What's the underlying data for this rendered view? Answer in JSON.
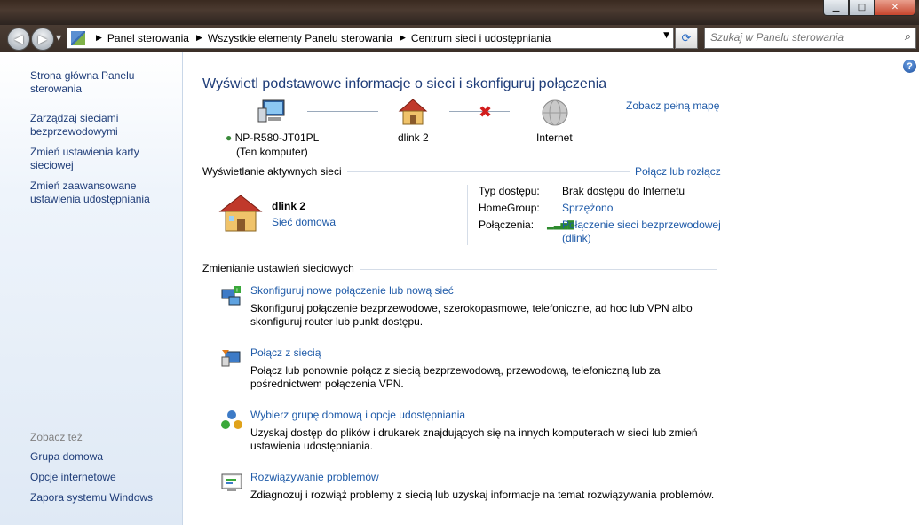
{
  "window": {
    "minimize": "▁",
    "maximize": "□",
    "close": "✕"
  },
  "nav": {
    "back": "◀",
    "forward": "▶",
    "breadcrumb": [
      "Panel sterowania",
      "Wszystkie elementy Panelu sterowania",
      "Centrum sieci i udostępniania"
    ],
    "search_placeholder": "Szukaj w Panelu sterowania"
  },
  "sidebar": {
    "items": [
      "Strona główna Panelu sterowania",
      "Zarządzaj sieciami bezprzewodowymi",
      "Zmień ustawienia karty sieciowej",
      "Zmień zaawansowane ustawienia udostępniania"
    ],
    "see_also": "Zobacz też",
    "see_items": [
      "Grupa domowa",
      "Opcje internetowe",
      "Zapora systemu Windows"
    ]
  },
  "main": {
    "title": "Wyświetl podstawowe informacje o sieci i skonfiguruj połączenia",
    "full_map": "Zobacz pełną mapę",
    "map": {
      "computer": "NP-R580-JT01PL",
      "computer_sub": "(Ten komputer)",
      "network": "dlink  2",
      "internet": "Internet"
    },
    "active": {
      "section": "Wyświetlanie aktywnych sieci",
      "connect": "Połącz lub rozłącz",
      "name": "dlink  2",
      "type": "Sieć domowa",
      "access_label": "Typ dostępu:",
      "access_value": "Brak dostępu do Internetu",
      "hg_label": "HomeGroup:",
      "hg_value": "Sprzężono",
      "conn_label": "Połączenia:",
      "conn_value_1": "Połączenie sieci bezprzewodowej",
      "conn_value_2": "(dlink)"
    },
    "settings": {
      "section": "Zmienianie ustawień sieciowych",
      "tasks": [
        {
          "title": "Skonfiguruj nowe połączenie lub nową sieć",
          "desc": "Skonfiguruj połączenie bezprzewodowe, szerokopasmowe, telefoniczne, ad hoc lub VPN albo skonfiguruj router lub punkt dostępu."
        },
        {
          "title": "Połącz z siecią",
          "desc": "Połącz lub ponownie połącz z siecią bezprzewodową, przewodową, telefoniczną lub za pośrednictwem połączenia VPN."
        },
        {
          "title": "Wybierz grupę domową i opcje udostępniania",
          "desc": "Uzyskaj dostęp do plików i drukarek znajdujących się na innych komputerach w sieci lub zmień ustawienia udostępniania."
        },
        {
          "title": "Rozwiązywanie problemów",
          "desc": "Zdiagnozuj i rozwiąż problemy z siecią lub uzyskaj informacje na temat rozwiązywania problemów."
        }
      ]
    }
  }
}
